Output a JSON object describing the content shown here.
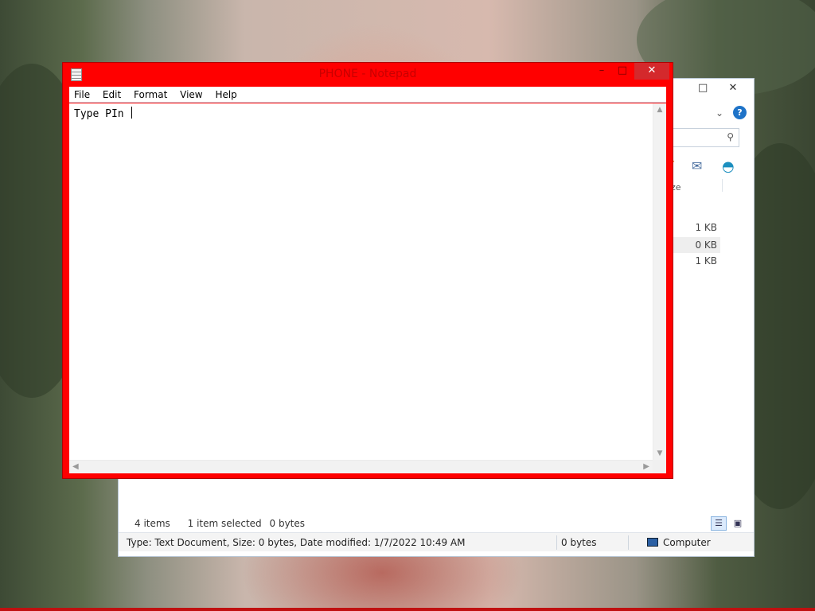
{
  "notepad": {
    "title": "PHONE - Notepad",
    "menu": [
      "File",
      "Edit",
      "Format",
      "View",
      "Help"
    ],
    "content": "Type PIn ",
    "controls": {
      "minimize": "–",
      "maximize": "□",
      "close": "✕"
    },
    "accent_color": "#ff0000"
  },
  "explorer": {
    "controls": {
      "maximize": "□",
      "close": "✕"
    },
    "help_label": "?",
    "column_header_fragment": "ze",
    "file_sizes": [
      "1 KB",
      "0 KB",
      "1 KB"
    ],
    "item_count": "4 items",
    "selection_info": "1 item selected",
    "selection_size": "0 bytes",
    "status": {
      "details": "Type: Text Document, Size: 0 bytes, Date modified: 1/7/2022 10:49 AM",
      "size": "0 bytes",
      "zone": "Computer"
    },
    "icons": [
      "search-icon",
      "edit-pencil-icon",
      "email-icon",
      "shell-icon",
      "details-view-icon",
      "tiles-view-icon",
      "computer-icon"
    ]
  }
}
